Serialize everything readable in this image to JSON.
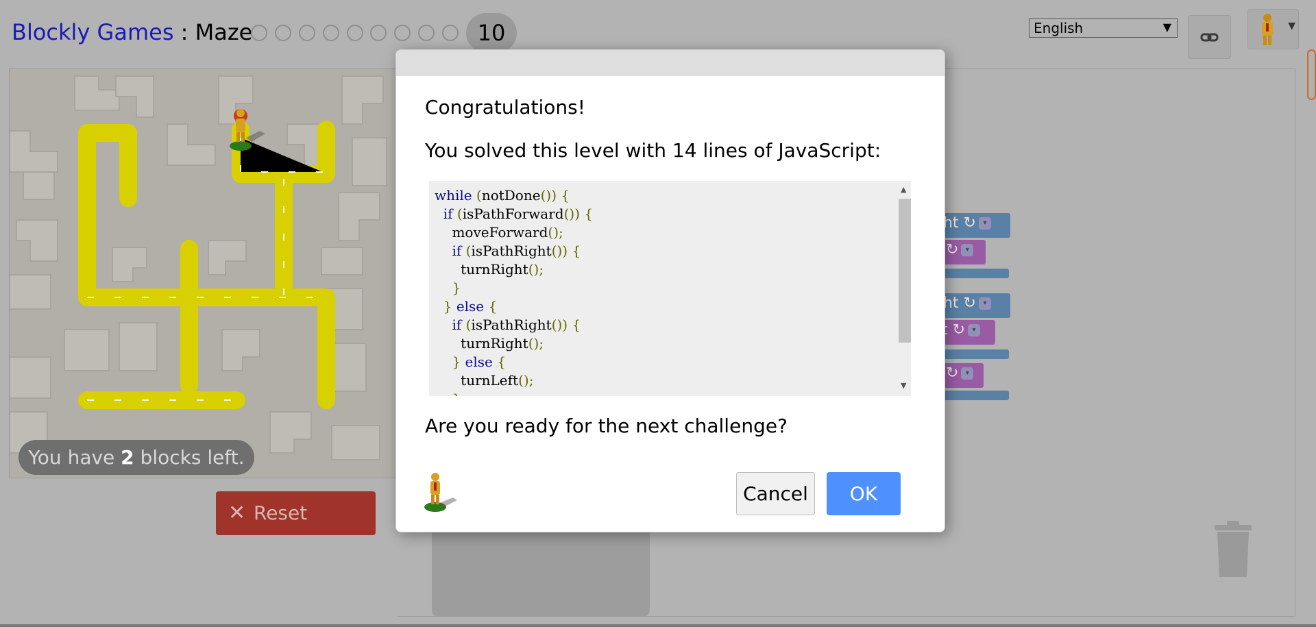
{
  "header": {
    "brand": "Blockly Games",
    "separator": " : ",
    "game": "Maze",
    "current_level": "10",
    "completed_levels": 9,
    "language": "English"
  },
  "maze": {
    "blocks_left_prefix": "You have ",
    "blocks_left_count": "2",
    "blocks_left_suffix": " blocks left.",
    "reset_label": "Reset"
  },
  "workspace": {
    "blocks": [
      {
        "label": "ght ↻",
        "color": "#5b80a5"
      },
      {
        "label": "↻",
        "color": "#9a5ba5"
      },
      {
        "label": "ght ↻",
        "color": "#5b80a5"
      },
      {
        "label": "t ↻",
        "color": "#9a5ba5"
      },
      {
        "label": "↻",
        "color": "#9a5ba5"
      }
    ]
  },
  "dialog": {
    "congrats": "Congratulations!",
    "solved": "You solved this level with 14 lines of JavaScript:",
    "code_lines": [
      "while (notDone()) {",
      "  if (isPathForward()) {",
      "    moveForward();",
      "    if (isPathRight()) {",
      "      turnRight();",
      "    }",
      "  } else {",
      "    if (isPathRight()) {",
      "      turnRight();",
      "    } else {",
      "      turnLeft();",
      "    }"
    ],
    "next": "Are you ready for the next challenge?",
    "cancel_label": "Cancel",
    "ok_label": "OK"
  },
  "colors": {
    "accent_blue": "#4d90fe",
    "reset_red": "#a0332a",
    "brand_blue": "#1a1ab4",
    "path_yellow": "#d8d000"
  }
}
